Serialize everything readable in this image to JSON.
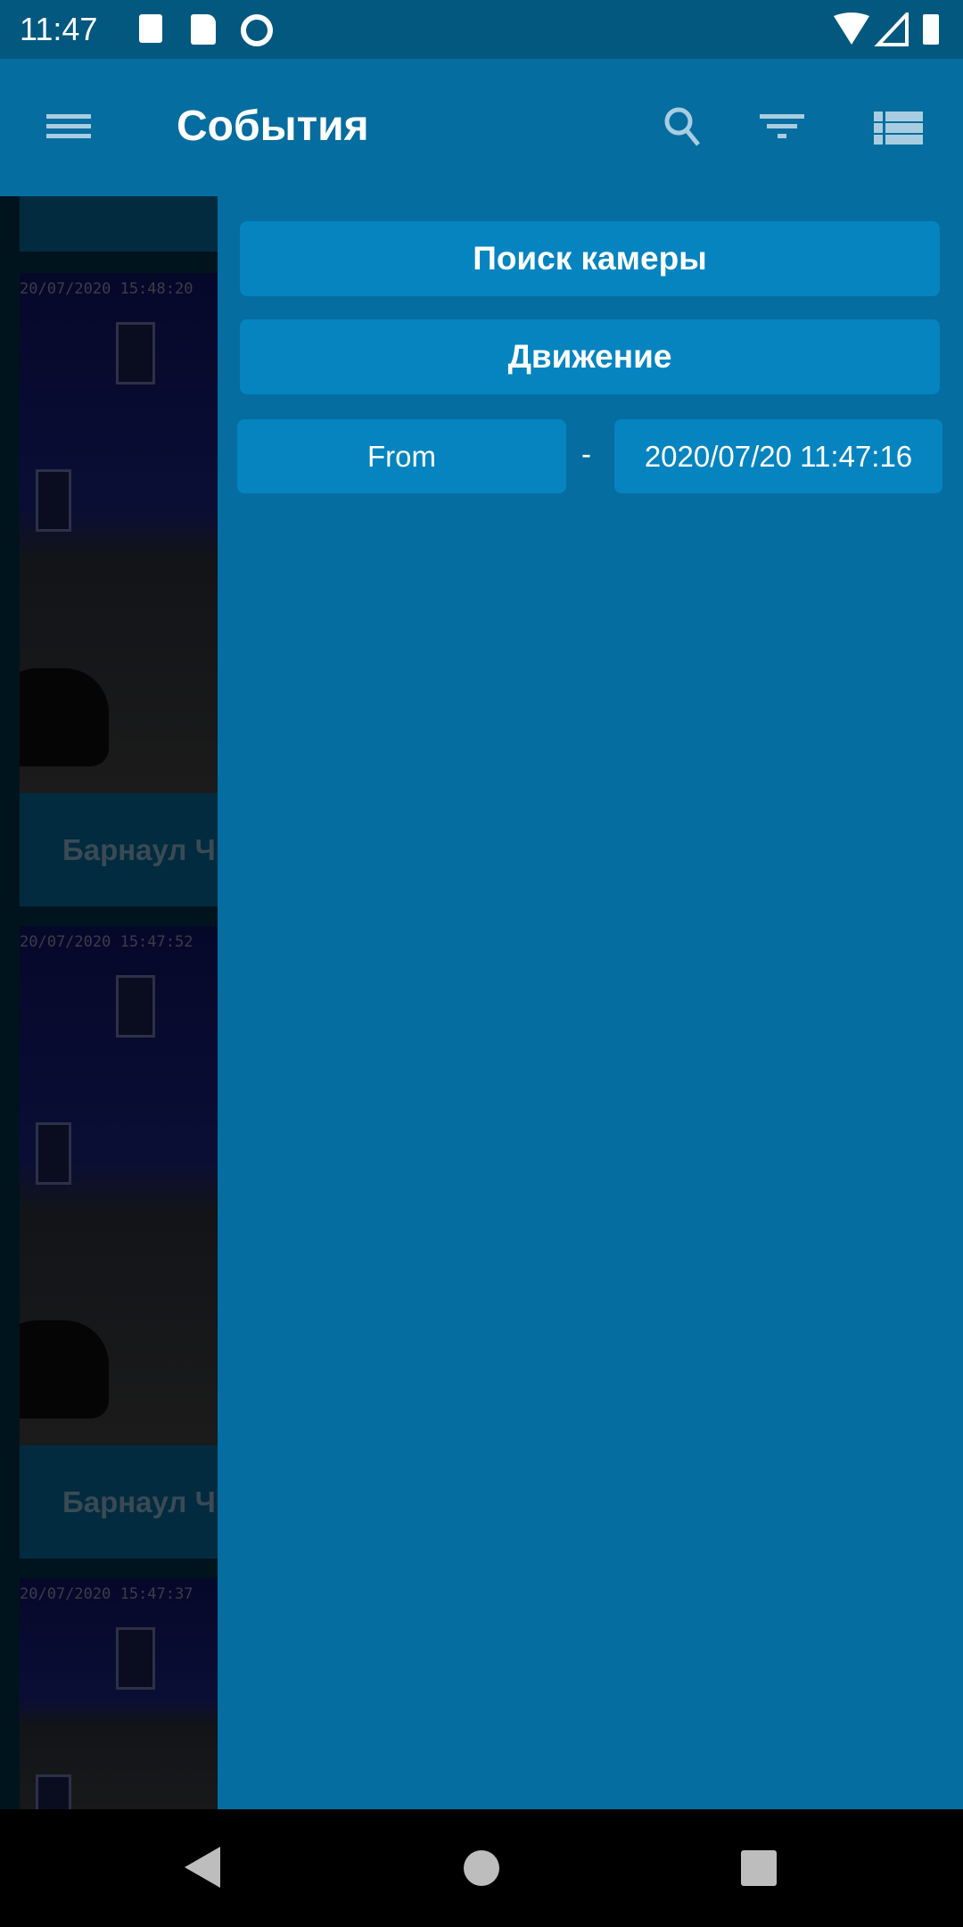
{
  "status_bar": {
    "time": "11:47",
    "icons": [
      "accessibility-a-icon",
      "sd-card-icon",
      "vpn-q-icon",
      "wifi-icon",
      "signal-icon",
      "battery-icon"
    ]
  },
  "app_bar": {
    "title": "События",
    "icons": [
      "menu-icon",
      "search-icon",
      "filter-icon",
      "list-view-icon"
    ]
  },
  "events": [
    {
      "timestamp": "20/07/2020 15:48:20",
      "label": "Барнаул Ч"
    },
    {
      "timestamp": "20/07/2020 15:47:52",
      "label": "Барнаул Ч"
    },
    {
      "timestamp": "20/07/2020 15:47:37",
      "label": ""
    }
  ],
  "filter_panel": {
    "camera_search_label": "Поиск камеры",
    "event_type_label": "Движение",
    "from_label": "From",
    "separator": "-",
    "to_value": "2020/07/20 11:47:16"
  },
  "colors": {
    "primary": "#056d9f",
    "button": "#0584c0",
    "status_bar": "#03587f"
  }
}
